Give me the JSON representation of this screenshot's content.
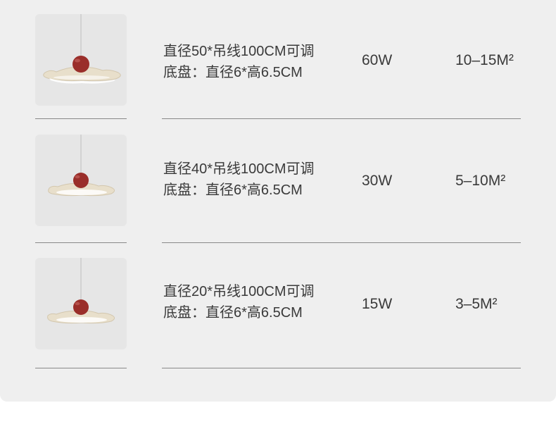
{
  "colors": {
    "panel_bg": "#efefef",
    "thumb_bg": "#e6e6e6",
    "shade": "#e8dfcb",
    "ball": "#9a2e2a",
    "divider": "#888888"
  },
  "products": [
    {
      "image": "pendant-lamp-image",
      "spec_line1": "直径50*吊线100CM可调",
      "spec_line2": "底盘：直径6*高6.5CM",
      "power": "60W",
      "area": "10–15M²"
    },
    {
      "image": "pendant-lamp-image",
      "spec_line1": "直径40*吊线100CM可调",
      "spec_line2": "底盘：直径6*高6.5CM",
      "power": "30W",
      "area": "5–10M²"
    },
    {
      "image": "pendant-lamp-image",
      "spec_line1": "直径20*吊线100CM可调",
      "spec_line2": "底盘：直径6*高6.5CM",
      "power": "15W",
      "area": "3–5M²"
    }
  ]
}
